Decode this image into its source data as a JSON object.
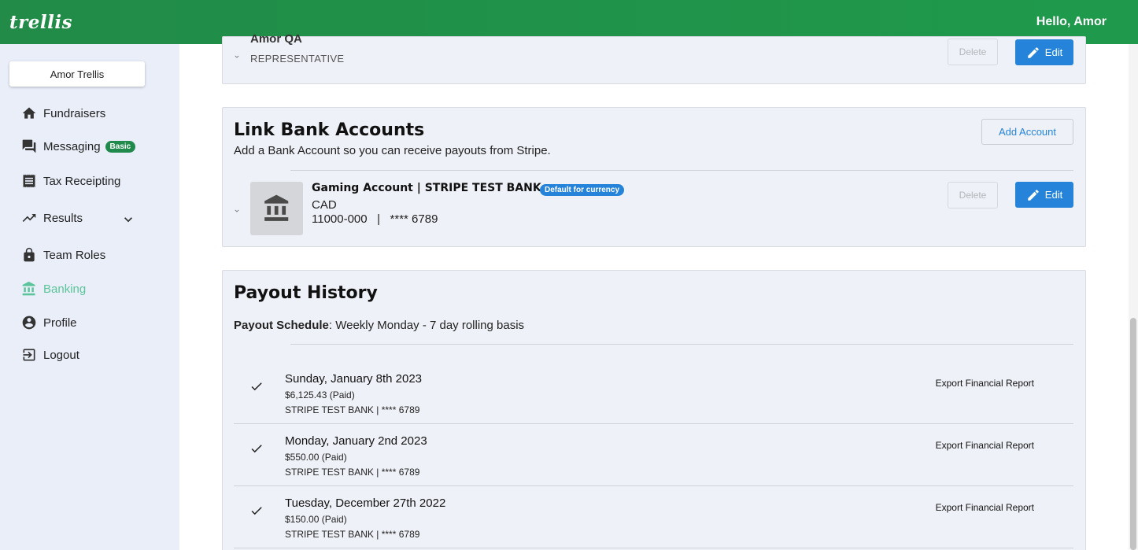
{
  "header": {
    "logo": "trellis",
    "greeting": "Hello, Amor"
  },
  "sidebar": {
    "user_button": "Amor Trellis",
    "items": [
      {
        "label": "Fundraisers",
        "icon": "home-icon"
      },
      {
        "label": "Messaging",
        "icon": "chat-icon",
        "badge": "Basic"
      },
      {
        "label": "Tax Receipting",
        "icon": "receipt-icon"
      },
      {
        "label": "Results",
        "icon": "trending-up-icon"
      },
      {
        "label": "Team Roles",
        "icon": "lock-icon"
      },
      {
        "label": "Banking",
        "icon": "bank-icon",
        "active": true
      },
      {
        "label": "Profile",
        "icon": "account-circle-icon"
      },
      {
        "label": "Logout",
        "icon": "logout-icon"
      }
    ]
  },
  "team_member": {
    "name": "Amor QA",
    "role": "REPRESENTATIVE",
    "delete_label": "Delete",
    "edit_label": "Edit"
  },
  "bank_accounts": {
    "title": "Link Bank Accounts",
    "subtitle": "Add a Bank Account so you can receive payouts from Stripe.",
    "add_label": "Add Account",
    "account": {
      "name": "Gaming Account | STRIPE TEST BANK",
      "badge": "Default for currency",
      "currency": "CAD",
      "number": "11000-000   |   **** 6789",
      "delete_label": "Delete",
      "edit_label": "Edit"
    }
  },
  "payout_history": {
    "title": "Payout History",
    "schedule_label": "Payout Schedule",
    "schedule_value": ": Weekly Monday - 7 day rolling basis",
    "payouts": [
      {
        "date": "Sunday, January 8th 2023",
        "amount": "$6,125.43 (Paid)",
        "bank": "STRIPE TEST BANK | **** 6789",
        "export": "Export Financial Report"
      },
      {
        "date": "Monday, January 2nd 2023",
        "amount": "$550.00 (Paid)",
        "bank": "STRIPE TEST BANK | **** 6789",
        "export": "Export Financial Report"
      },
      {
        "date": "Tuesday, December 27th 2022",
        "amount": "$150.00 (Paid)",
        "bank": "STRIPE TEST BANK | **** 6789",
        "export": "Export Financial Report"
      }
    ]
  },
  "colors": {
    "brand_green": "#1f9a4c",
    "accent_blue": "#2584d9",
    "active_nav": "#5cc49a"
  }
}
